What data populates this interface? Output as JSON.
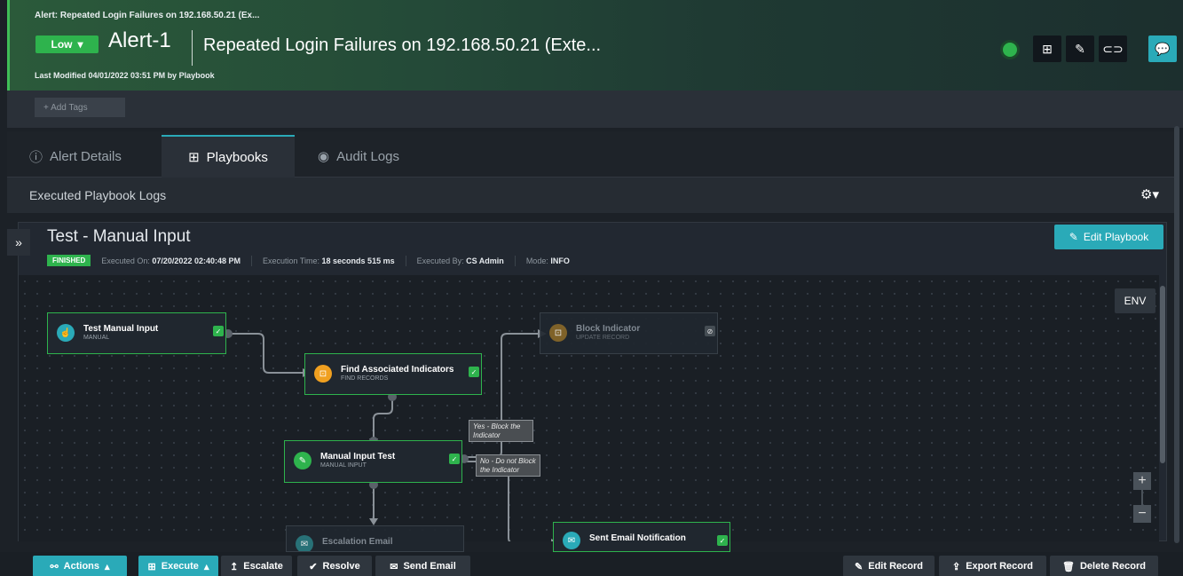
{
  "header": {
    "breadcrumb": "Alert: Repeated Login Failures on 192.168.50.21 (Ex...",
    "severity": "Low",
    "alert_id": "Alert-1",
    "title": "Repeated Login Failures on 192.168.50.21 (Exte...",
    "last_modified": "Last Modified 04/01/2022 03:51 PM by Playbook"
  },
  "tags": {
    "add_label": "+ Add Tags"
  },
  "tabs": [
    {
      "label": "Alert Details",
      "icon": "info-icon"
    },
    {
      "label": "Playbooks",
      "icon": "playbook-icon"
    },
    {
      "label": "Audit Logs",
      "icon": "eye-icon"
    }
  ],
  "exec_logs": {
    "title": "Executed Playbook Logs"
  },
  "playbook": {
    "name": "Test - Manual Input",
    "status": "FINISHED",
    "executed_on_label": "Executed On:",
    "executed_on": "07/20/2022 02:40:48 PM",
    "execution_time_label": "Execution Time:",
    "execution_time": "18 seconds 515 ms",
    "executed_by_label": "Executed By:",
    "executed_by": "CS Admin",
    "mode_label": "Mode:",
    "mode": "INFO",
    "edit_label": "Edit Playbook"
  },
  "canvas": {
    "env_label": "ENV",
    "zoom_in": "+",
    "zoom_out": "−"
  },
  "nodes": [
    {
      "title": "Test Manual Input",
      "sub": "MANUAL",
      "color": "#2aaab8"
    },
    {
      "title": "Find Associated Indicators",
      "sub": "FIND RECORDS",
      "color": "#f0a020"
    },
    {
      "title": "Block Indicator",
      "sub": "UPDATE RECORD",
      "color": "#f0a020"
    },
    {
      "title": "Manual Input Test",
      "sub": "MANUAL INPUT",
      "color": "#2eb34d"
    },
    {
      "title": "Escalation Email",
      "sub": "",
      "color": "#2aaab8"
    },
    {
      "title": "Sent Email Notification",
      "sub": "",
      "color": "#2aaab8"
    }
  ],
  "branch_labels": {
    "yes": "Yes - Block the Indicator",
    "no": "No - Do not Block the Indicator"
  },
  "bottom": {
    "actions": "Actions",
    "execute": "Execute",
    "escalate": "Escalate",
    "resolve": "Resolve",
    "send_email": "Send Email",
    "edit_record": "Edit Record",
    "export_record": "Export Record",
    "delete_record": "Delete Record"
  },
  "colors": {
    "accent": "#2aaab8",
    "success": "#2eb34d",
    "warning": "#f0a020"
  }
}
